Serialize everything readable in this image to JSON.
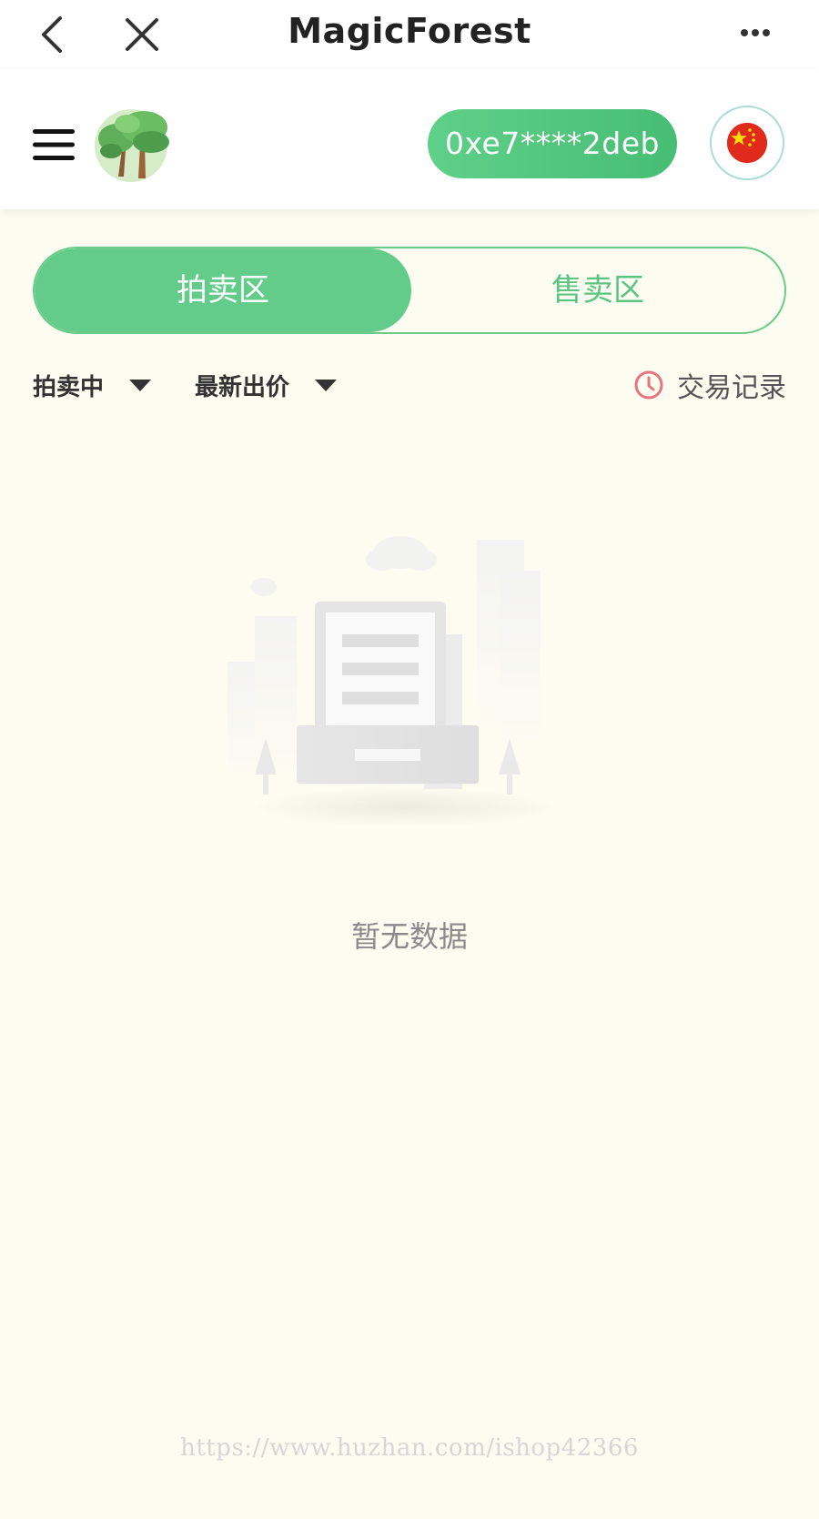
{
  "topbar": {
    "title": "MagicForest",
    "back_icon": "chevron-left-icon",
    "close_icon": "close-icon",
    "more_icon": "more-dots-icon"
  },
  "header": {
    "menu_icon": "hamburger-menu-icon",
    "logo_icon": "tree-logo-icon",
    "wallet_address": "0xe7****2deb",
    "language_icon": "china-flag-icon"
  },
  "tabs": [
    {
      "label": "拍卖区",
      "active": true
    },
    {
      "label": "售卖区",
      "active": false
    }
  ],
  "filters": {
    "status": "拍卖中",
    "sort": "最新出价",
    "history_label": "交易记录",
    "history_icon": "clock-icon"
  },
  "empty": {
    "text": "暂无数据",
    "icon": "empty-document-illustration"
  },
  "watermark": "https://www.huzhan.com/ishop42366",
  "colors": {
    "accent": "#63cc8a",
    "background": "#fdfcf1",
    "wallet_bg": "#4fc47c",
    "flag_red": "#e02a1b",
    "flag_star": "#ffde00"
  }
}
